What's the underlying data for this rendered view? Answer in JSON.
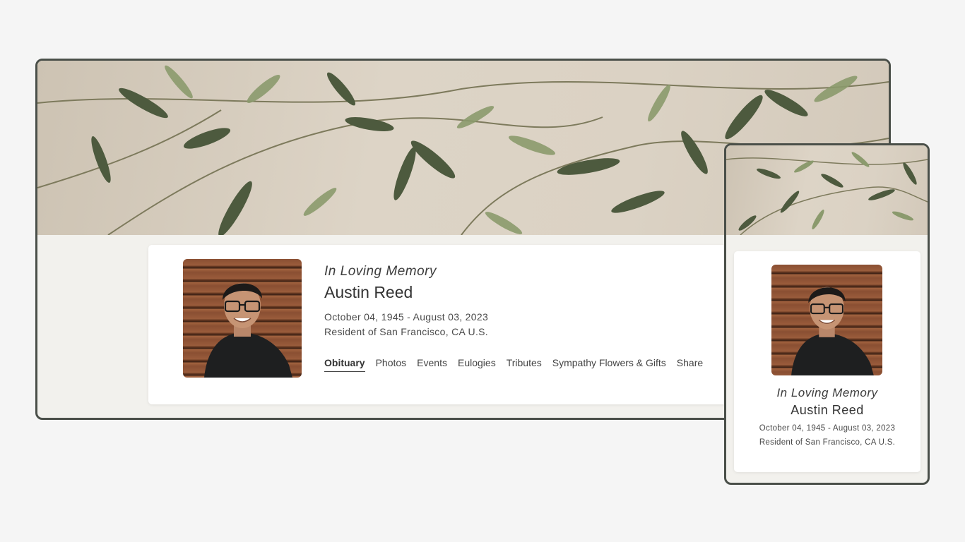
{
  "desktop": {
    "heading": "In Loving Memory",
    "name": "Austin Reed",
    "dates": "October 04, 1945 - August 03, 2023",
    "residence": "Resident of San Francisco, CA U.S.",
    "tabs": [
      {
        "label": "Obituary",
        "active": true
      },
      {
        "label": "Photos"
      },
      {
        "label": "Events"
      },
      {
        "label": "Eulogies"
      },
      {
        "label": "Tributes"
      },
      {
        "label": "Sympathy Flowers & Gifts"
      },
      {
        "label": "Share"
      }
    ]
  },
  "mobile": {
    "heading": "In Loving Memory",
    "name": "Austin Reed",
    "dates": "October 04, 1945 - August 03, 2023",
    "residence": "Resident of San Francisco, CA U.S."
  },
  "colors": {
    "page_background": "#f5f5f5",
    "frame_border": "#4a4f49",
    "content_background": "#f2f1ed",
    "card_background": "#ffffff",
    "banner_background": "#d9d0c2",
    "leaf_dark": "#4a5a40",
    "leaf_light": "#8a9a6a"
  },
  "icons": {
    "banner": "olive-branch-image",
    "portrait": "person-photo"
  }
}
